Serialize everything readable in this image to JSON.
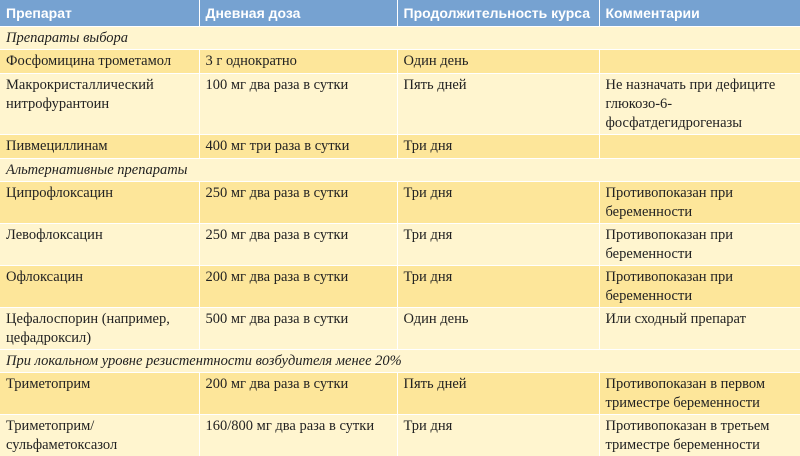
{
  "header": [
    "Препарат",
    "Дневная доза",
    "Продолжительность курса",
    "Комментарии"
  ],
  "sections": [
    {
      "title": "Препараты выбора",
      "rows": [
        [
          "Фосфомицина трометамол",
          "3 г однократно",
          "Один день",
          ""
        ],
        [
          "Макрокристаллический нитрофурантоин",
          "100 мг два раза в сутки",
          "Пять дней",
          "Не назначать при дефиците глюкозо-6-фосфатдегидрогеназы"
        ],
        [
          "Пивмециллинам",
          "400 мг три раза в сутки",
          "Три дня",
          ""
        ]
      ]
    },
    {
      "title": "Альтернативные препараты",
      "rows": [
        [
          "Ципрофлоксацин",
          "250 мг два раза в сутки",
          "Три дня",
          "Противопоказан при беременности"
        ],
        [
          "Левофлоксацин",
          "250 мг два раза в сутки",
          "Три дня",
          "Противопоказан при беременности"
        ],
        [
          "Офлоксацин",
          "200 мг два раза в сутки",
          "Три дня",
          "Противопоказан при беременности"
        ],
        [
          "Цефалоспорин (например, цефадроксил)",
          "500 мг два раза в сутки",
          "Один день",
          "Или сходный препарат"
        ]
      ]
    },
    {
      "title": "При локальном уровне резистентности возбудителя менее 20%",
      "rows": [
        [
          "Триметоприм",
          "200 мг два раза в сутки",
          "Пять дней",
          "Противопоказан в первом триместре беременности"
        ],
        [
          "Триметоприм/ сульфаметоксазол",
          "160/800 мг два раза в сутки",
          "Три дня",
          "Противопоказан в третьем триместре беременности"
        ]
      ]
    }
  ]
}
